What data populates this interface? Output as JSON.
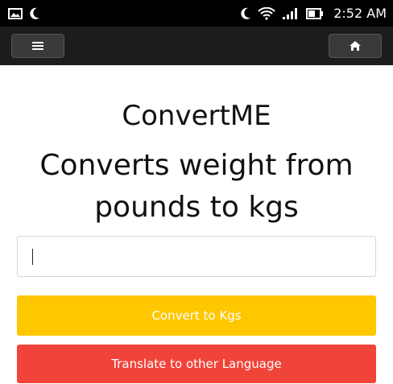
{
  "status_bar": {
    "time": "2:52 AM",
    "icons": [
      "image-icon",
      "moon-icon",
      "wifi-icon",
      "signal-icon",
      "battery-icon"
    ]
  },
  "app_bar": {
    "menu_icon": "hamburger-menu-icon",
    "home_icon": "home-icon"
  },
  "content": {
    "app_title": "ConvertME",
    "subtitle": "Converts weight from pounds to kgs",
    "input_value": ""
  },
  "buttons": {
    "convert_label": "Convert to Kgs",
    "translate_label": "Translate to other Language"
  },
  "colors": {
    "convert_bg": "#ffc700",
    "translate_bg": "#f0443a",
    "status_bar_bg": "#000000",
    "app_bar_bg": "#1c1c1c"
  }
}
